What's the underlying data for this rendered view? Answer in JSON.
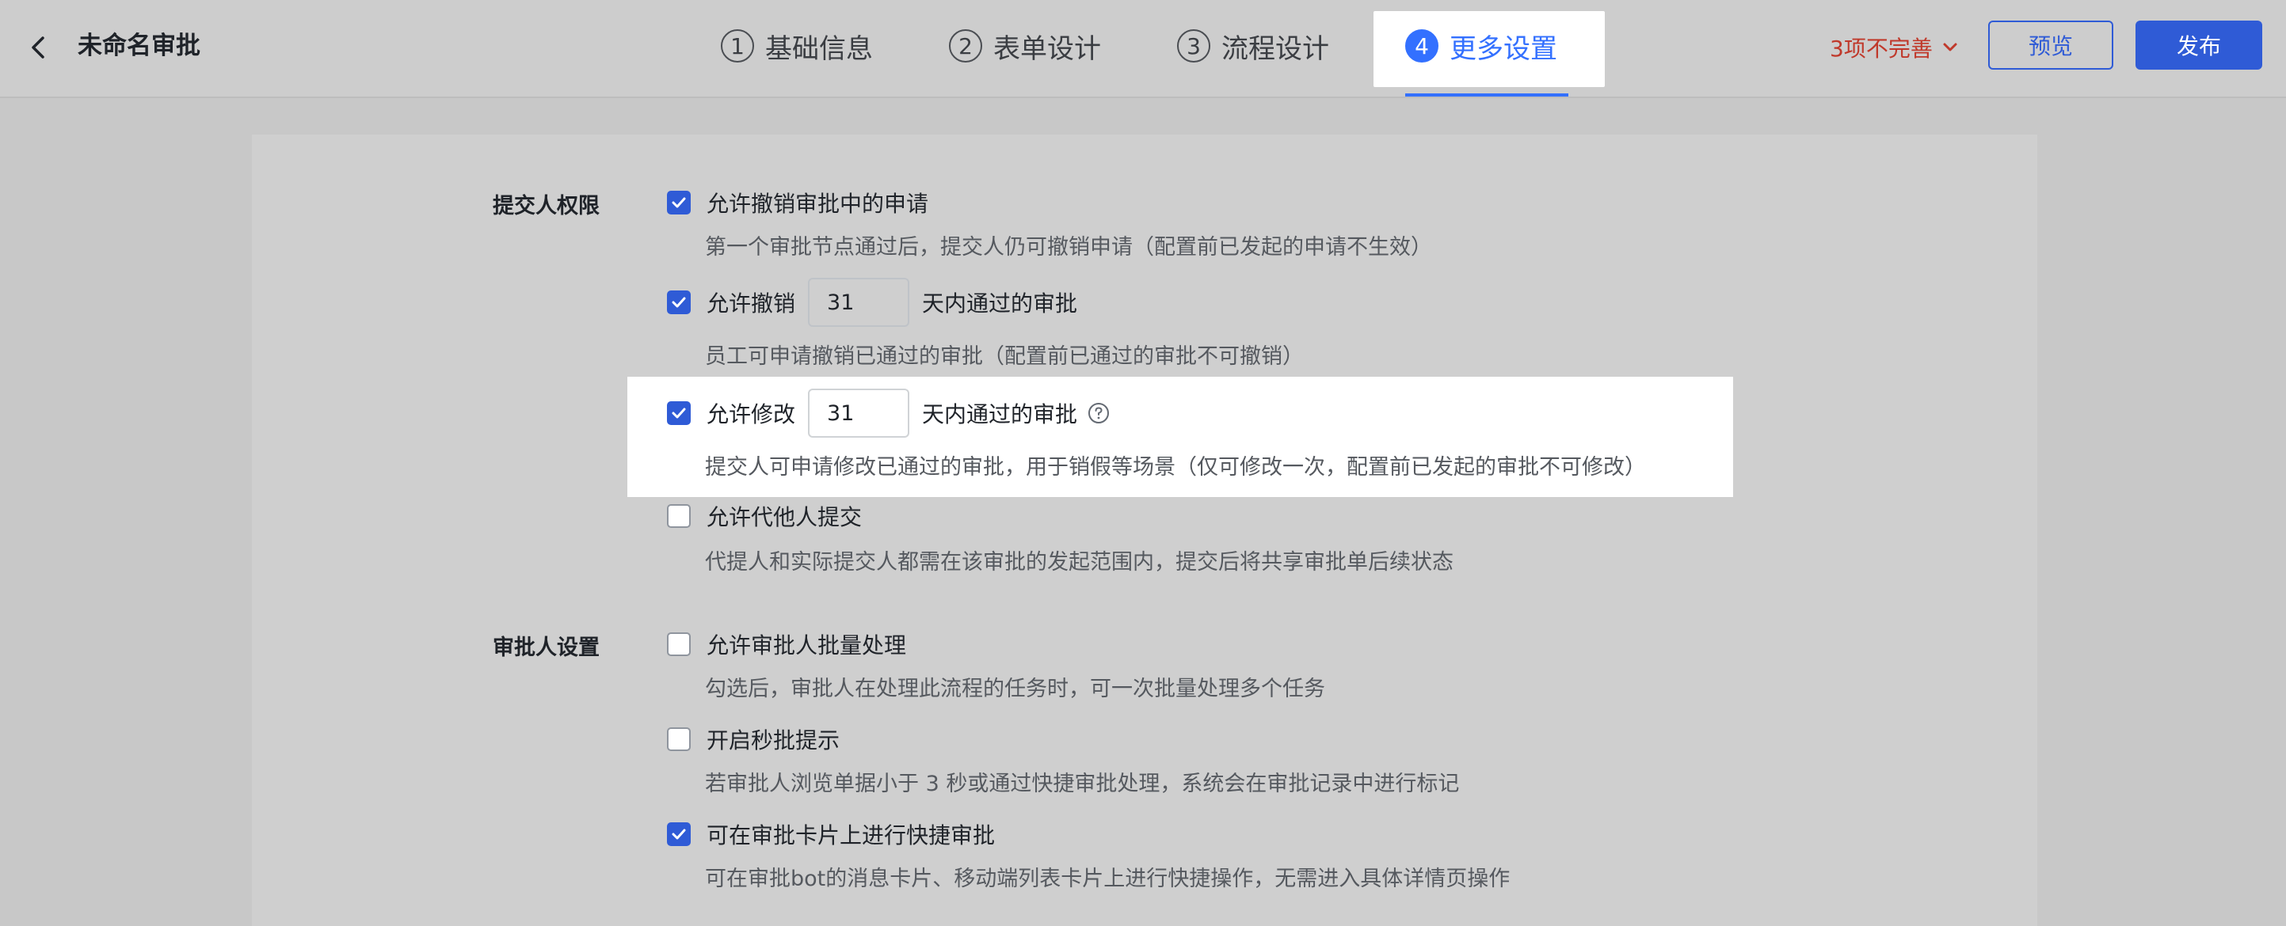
{
  "header": {
    "title": "未命名审批",
    "steps": [
      {
        "num": "1",
        "label": "基础信息"
      },
      {
        "num": "2",
        "label": "表单设计"
      },
      {
        "num": "3",
        "label": "流程设计"
      },
      {
        "num": "4",
        "label": "更多设置",
        "active": true
      }
    ],
    "incomplete_label": "3项不完善",
    "preview_label": "预览",
    "publish_label": "发布"
  },
  "colors": {
    "accent": "#3370ff",
    "primary_button": "#2f5bd6",
    "warning_text": "#c0392b"
  },
  "sections": {
    "submitter": {
      "label": "提交人权限",
      "items": [
        {
          "label": "允许撤销审批中的申请",
          "checked": true,
          "desc": "第一个审批节点通过后，提交人仍可撤销申请（配置前已发起的申请不生效）"
        },
        {
          "label": "允许撤销",
          "checked": true,
          "days": "31",
          "suffix": "天内通过的审批",
          "desc": "员工可申请撤销已通过的审批（配置前已通过的审批不可撤销）"
        },
        {
          "label": "允许修改",
          "checked": true,
          "days": "31",
          "suffix": "天内通过的审批",
          "desc": "提交人可申请修改已通过的审批，用于销假等场景（仅可修改一次，配置前已发起的审批不可修改）"
        },
        {
          "label": "允许代他人提交",
          "checked": false,
          "desc": "代提人和实际提交人都需在该审批的发起范围内，提交后将共享审批单后续状态"
        }
      ]
    },
    "approver": {
      "label": "审批人设置",
      "items": [
        {
          "label": "允许审批人批量处理",
          "checked": false,
          "desc": "勾选后，审批人在处理此流程的任务时，可一次批量处理多个任务"
        },
        {
          "label": "开启秒批提示",
          "checked": false,
          "desc": "若审批人浏览单据小于 3 秒或通过快捷审批处理，系统会在审批记录中进行标记"
        },
        {
          "label": "可在审批卡片上进行快捷审批",
          "checked": true,
          "desc": "可在审批bot的消息卡片、移动端列表卡片上进行快捷操作，无需进入具体详情页操作"
        }
      ]
    }
  }
}
